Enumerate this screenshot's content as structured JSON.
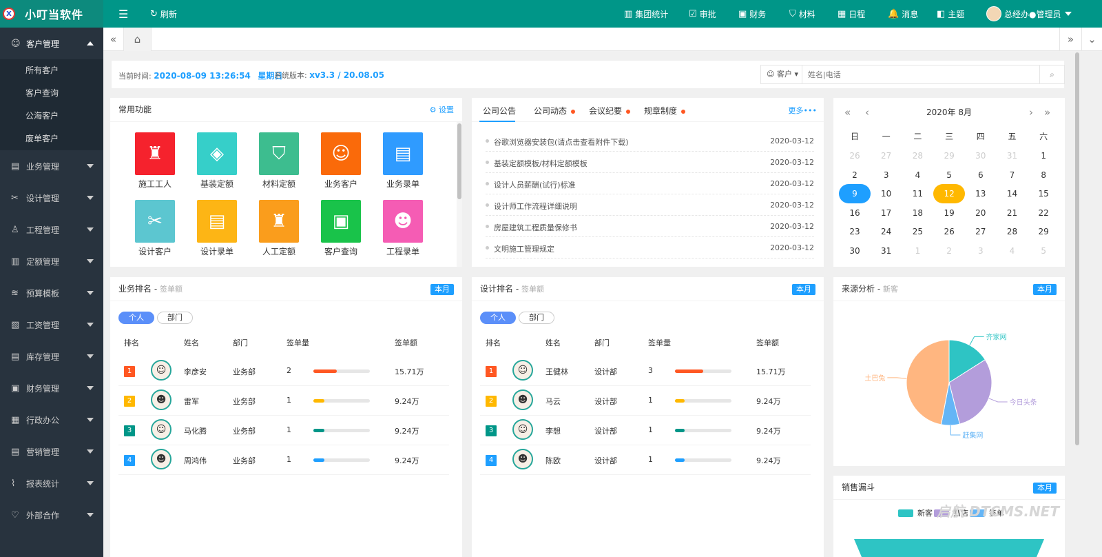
{
  "app": {
    "title": "小叮当软件",
    "logo": "X"
  },
  "topbar": {
    "menu_icon": "menu-fold-icon",
    "refresh": "刷新",
    "items": [
      {
        "icon": "chart-icon",
        "label": "集团统计",
        "glyph": "▥"
      },
      {
        "icon": "check-square-icon",
        "label": "审批",
        "glyph": "☑"
      },
      {
        "icon": "finance-icon",
        "label": "财务",
        "glyph": "▣"
      },
      {
        "icon": "material-icon",
        "label": "材料",
        "glyph": "⛉"
      },
      {
        "icon": "calendar-icon",
        "label": "日程",
        "glyph": "▦"
      },
      {
        "icon": "bell-icon",
        "label": "消息",
        "glyph": "🔔"
      },
      {
        "icon": "theme-icon",
        "label": "主题",
        "glyph": "◧"
      }
    ],
    "user": "总经办●管理员"
  },
  "sidebar": {
    "groups": [
      {
        "label": "客户管理",
        "icon": "user-icon",
        "glyph": "☺",
        "open": true,
        "children": [
          "所有客户",
          "客户查询",
          "公海客户",
          "废单客户"
        ]
      },
      {
        "label": "业务管理",
        "icon": "briefcase-icon",
        "glyph": "▤"
      },
      {
        "label": "设计管理",
        "icon": "design-icon",
        "glyph": "✂"
      },
      {
        "label": "工程管理",
        "icon": "worker-icon",
        "glyph": "♙"
      },
      {
        "label": "定额管理",
        "icon": "building-icon",
        "glyph": "▥"
      },
      {
        "label": "预算模板",
        "icon": "layers-icon",
        "glyph": "≋"
      },
      {
        "label": "工资管理",
        "icon": "salary-icon",
        "glyph": "▧"
      },
      {
        "label": "库存管理",
        "icon": "inventory-icon",
        "glyph": "▤"
      },
      {
        "label": "财务管理",
        "icon": "finance-icon",
        "glyph": "▣"
      },
      {
        "label": "行政办公",
        "icon": "office-icon",
        "glyph": "▦"
      },
      {
        "label": "营销管理",
        "icon": "marketing-icon",
        "glyph": "▤"
      },
      {
        "label": "报表统计",
        "icon": "report-icon",
        "glyph": "⌇"
      },
      {
        "label": "外部合作",
        "icon": "handshake-icon",
        "glyph": "♡"
      }
    ]
  },
  "info": {
    "time_label": "当前时间:",
    "time": "2020-08-09 13:26:54",
    "weekday": "星期日",
    "version_label": "系统版本:",
    "version": "xv3.3 / 20.08.05"
  },
  "search": {
    "type": "客户",
    "placeholder": "姓名|电话"
  },
  "common": {
    "title": "常用功能",
    "settings": "设置",
    "tiles": [
      {
        "label": "施工工人",
        "color": "#f5222d",
        "glyph": "♜"
      },
      {
        "label": "基装定额",
        "color": "#36cfc9",
        "glyph": "◈"
      },
      {
        "label": "材料定额",
        "color": "#3dbd8f",
        "glyph": "⛉"
      },
      {
        "label": "业务客户",
        "color": "#fa6a0a",
        "glyph": "☺"
      },
      {
        "label": "业务录单",
        "color": "#2f9bff",
        "glyph": "▤"
      },
      {
        "label": "设计客户",
        "color": "#5cc6d0",
        "glyph": "✂"
      },
      {
        "label": "设计录单",
        "color": "#fdb515",
        "glyph": "▤"
      },
      {
        "label": "人工定额",
        "color": "#fa9d1c",
        "glyph": "♜"
      },
      {
        "label": "客户查询",
        "color": "#19c34a",
        "glyph": "▣"
      },
      {
        "label": "工程录单",
        "color": "#f55cb4",
        "glyph": "☻"
      }
    ]
  },
  "news": {
    "tabs": [
      "公司公告",
      "公司动态",
      "会议纪要",
      "规章制度"
    ],
    "more": "更多•••",
    "items": [
      {
        "title": "谷歌浏览器安装包(请点击查看附件下载)",
        "date": "2020-03-12"
      },
      {
        "title": "基装定额模板/材料定额模板",
        "date": "2020-03-12"
      },
      {
        "title": "设计人员薪酬(试行)标准",
        "date": "2020-03-12"
      },
      {
        "title": "设计师工作流程详细说明",
        "date": "2020-03-12"
      },
      {
        "title": "房屋建筑工程质量保修书",
        "date": "2020-03-12"
      },
      {
        "title": "文明施工管理规定",
        "date": "2020-03-12"
      }
    ]
  },
  "calendar": {
    "title": "2020年  8月",
    "weekdays": [
      "日",
      "一",
      "二",
      "三",
      "四",
      "五",
      "六"
    ],
    "days": [
      "26",
      "27",
      "28",
      "29",
      "30",
      "31",
      "1",
      "2",
      "3",
      "4",
      "5",
      "6",
      "7",
      "8",
      "9",
      "10",
      "11",
      "12",
      "13",
      "14",
      "15",
      "16",
      "17",
      "18",
      "19",
      "20",
      "21",
      "22",
      "23",
      "24",
      "25",
      "26",
      "27",
      "28",
      "29",
      "30",
      "31",
      "1",
      "2",
      "3",
      "4",
      "5"
    ],
    "selected": "9",
    "today": "12"
  },
  "sales_rank": {
    "title": "业务排名",
    "subtitle": "签单额",
    "badge": "本月",
    "seg": [
      "个人",
      "部门"
    ],
    "headers": [
      "排名",
      "姓名",
      "部门",
      "签单量",
      "签单额"
    ],
    "rows": [
      {
        "rank": "1",
        "name": "李彦安",
        "dept": "业务部",
        "count": "2",
        "amount": "15.71万",
        "pct": 0.42,
        "color": "#ff5722",
        "face": "☺"
      },
      {
        "rank": "2",
        "name": "雷军",
        "dept": "业务部",
        "count": "1",
        "amount": "9.24万",
        "pct": 0.2,
        "color": "#ffb800",
        "face": "☻"
      },
      {
        "rank": "3",
        "name": "马化腾",
        "dept": "业务部",
        "count": "1",
        "amount": "9.24万",
        "pct": 0.2,
        "color": "#009688",
        "face": "☺"
      },
      {
        "rank": "4",
        "name": "周鸿伟",
        "dept": "业务部",
        "count": "1",
        "amount": "9.24万",
        "pct": 0.2,
        "color": "#1e9fff",
        "face": "☻"
      }
    ]
  },
  "design_rank": {
    "title": "设计排名",
    "subtitle": "签单额",
    "badge": "本月",
    "seg": [
      "个人",
      "部门"
    ],
    "headers": [
      "排名",
      "姓名",
      "部门",
      "签单量",
      "签单额"
    ],
    "rows": [
      {
        "rank": "1",
        "name": "王健林",
        "dept": "设计部",
        "count": "3",
        "amount": "15.71万",
        "pct": 0.5,
        "color": "#ff5722",
        "face": "☺"
      },
      {
        "rank": "2",
        "name": "马云",
        "dept": "设计部",
        "count": "1",
        "amount": "9.24万",
        "pct": 0.17,
        "color": "#ffb800",
        "face": "☻"
      },
      {
        "rank": "3",
        "name": "李想",
        "dept": "设计部",
        "count": "1",
        "amount": "9.24万",
        "pct": 0.17,
        "color": "#009688",
        "face": "☺"
      },
      {
        "rank": "4",
        "name": "陈欧",
        "dept": "设计部",
        "count": "1",
        "amount": "9.24万",
        "pct": 0.17,
        "color": "#1e9fff",
        "face": "☻"
      }
    ]
  },
  "source": {
    "title": "来源分析",
    "subtitle": "新客",
    "badge": "本月",
    "chart_data": {
      "type": "pie",
      "slices": [
        {
          "name": "齐家网",
          "value": 16,
          "color": "#2ec4c4"
        },
        {
          "name": "今日头条",
          "value": 30,
          "color": "#b39ddb"
        },
        {
          "name": "赶集网",
          "value": 7,
          "color": "#64b5f6"
        },
        {
          "name": "土巴兔",
          "value": 47,
          "color": "#ffb680"
        }
      ]
    }
  },
  "funnel": {
    "title": "销售漏斗",
    "badge": "本月",
    "legend": [
      {
        "name": "新客",
        "color": "#2ec4c4"
      },
      {
        "name": "到店",
        "color": "#b39ddb"
      },
      {
        "name": "签单",
        "color": "#64b5f6"
      }
    ]
  },
  "watermark": "启航 DTCMS.NET"
}
